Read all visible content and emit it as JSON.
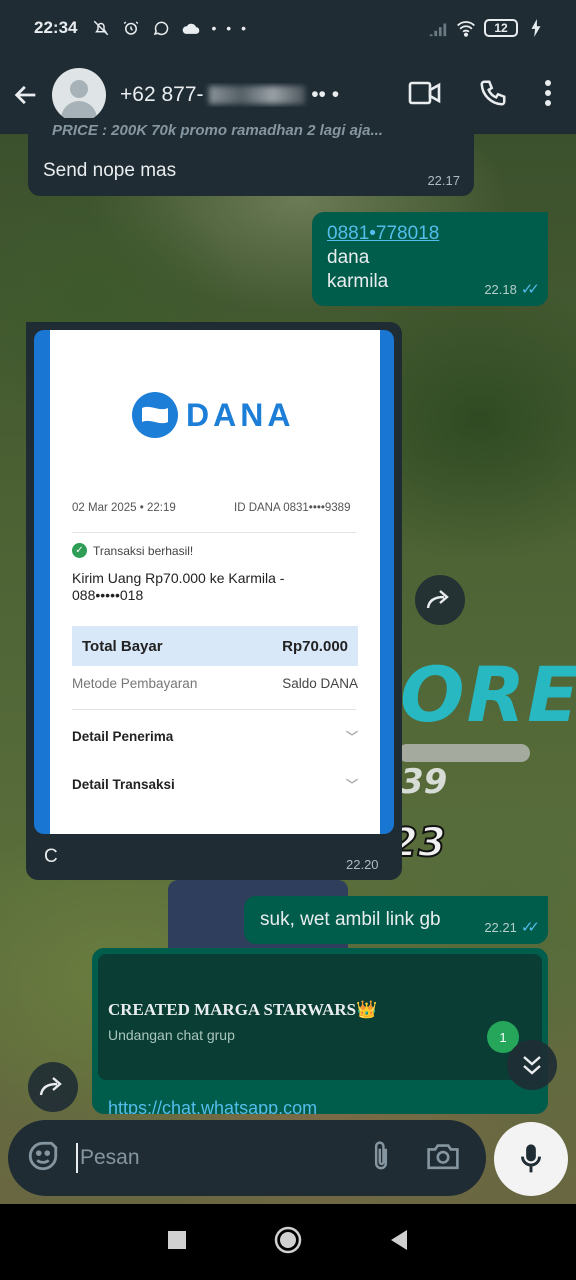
{
  "status_bar": {
    "time": "22:34",
    "battery": "12",
    "dots": "• • •"
  },
  "header": {
    "contact_name": "+62 877-",
    "contact_name_tail": "•• •"
  },
  "messages": {
    "m1": {
      "quoted": "PRICE : 200K 70k promo ramadhan  2 lagi aja...",
      "text": "Send nope mas",
      "time": "22.17"
    },
    "m2": {
      "link": "0881•778018",
      "line2": "dana",
      "line3": "karmila",
      "time": "22.18"
    },
    "m3": {
      "caption": "C",
      "time": "22.20"
    },
    "m4": {
      "text": "suk, wet ambil link gb",
      "time": "22.21"
    },
    "m5": {
      "group_title": "CREATED MARGA STARWARS👑",
      "group_subtitle": "Undangan chat grup",
      "link": "https://chat.whatsapp.com"
    }
  },
  "receipt": {
    "brand": "DANA",
    "date": "02 Mar 2025 • 22:19",
    "id": "ID DANA 0831••••9389",
    "status": "Transaksi berhasil!",
    "kirim_line1": "Kirim Uang Rp70.000 ke Karmila -",
    "kirim_line2": "088•••••018",
    "total_label": "Total Bayar",
    "total_value": "Rp70.000",
    "method_label": "Metode Pembayaran",
    "method_value": "Saldo DANA",
    "detail_penerima": "Detail Penerima",
    "detail_transaksi": "Detail Transaksi"
  },
  "unread_badge": "1",
  "input": {
    "placeholder": "Pesan"
  },
  "colors": {
    "incoming_bubble": "#1f2c34",
    "outgoing_bubble": "#005c4b",
    "read_ticks": "#53bdeb",
    "dana_blue": "#1c7ed6"
  },
  "icons": [
    "back-arrow-icon",
    "video-call-icon",
    "phone-icon",
    "more-vert-icon",
    "forward-icon",
    "scroll-down-icon",
    "sticker-icon",
    "attach-icon",
    "camera-icon",
    "mic-icon",
    "nav-square-icon",
    "nav-circle-icon",
    "nav-triangle-icon"
  ]
}
